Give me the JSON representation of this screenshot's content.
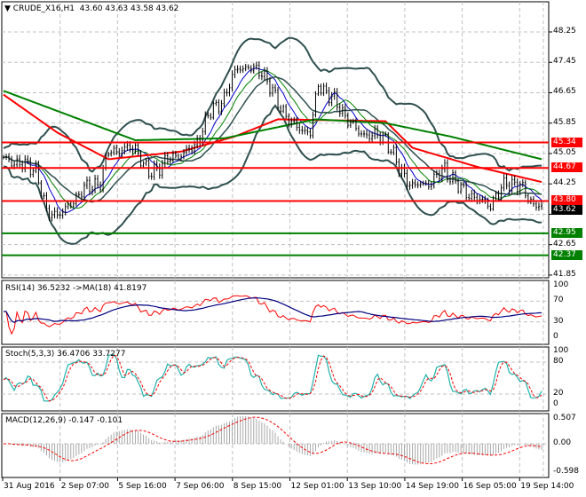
{
  "header": {
    "symbol": "CRUDE_X16,H1",
    "ohlc": "43.60 43.63 43.58 43.62"
  },
  "price_axis": [
    "48.25",
    "47.45",
    "46.65",
    "45.85",
    "45.05",
    "44.25",
    "43.45",
    "42.65",
    "41.85"
  ],
  "hlines": [
    {
      "label": "45.34",
      "value": 45.34,
      "color": "#ff0000"
    },
    {
      "label": "44.67",
      "value": 44.67,
      "color": "#ff0000"
    },
    {
      "label": "43.80",
      "value": 43.8,
      "color": "#ff0000"
    },
    {
      "label": "42.95",
      "value": 42.95,
      "color": "#008000"
    },
    {
      "label": "42.37",
      "value": 42.37,
      "color": "#008000"
    }
  ],
  "current_price": {
    "label": "43.62",
    "value": 43.62
  },
  "time_axis": [
    "31 Aug 2016",
    "2 Sep 07:00",
    "5 Sep 16:00",
    "7 Sep 06:00",
    "8 Sep 15:00",
    "12 Sep 01:00",
    "13 Sep 10:00",
    "14 Sep 19:00",
    "16 Sep 05:00",
    "19 Sep 14:00"
  ],
  "rsi": {
    "header": "RSI(14) 36.5232  ->MA(18) 41.8197",
    "axis": [
      "100",
      "70",
      "30",
      "0"
    ]
  },
  "stoch": {
    "header": "Stoch(5,3,3) 36.4706 33.7277",
    "axis": [
      "100",
      "80",
      "20",
      "0"
    ]
  },
  "macd": {
    "header": "MACD(12,26,9) -0.147 -0.101",
    "axis": [
      "0.507",
      "0.00",
      "-0.598"
    ]
  },
  "chart_data": {
    "type": "candlestick",
    "title": "CRUDE_X16,H1",
    "bars": 201,
    "ylim": [
      41.85,
      48.25
    ],
    "close_keypoints": [
      [
        0,
        44.9
      ],
      [
        1,
        44.89
      ],
      [
        12,
        44.65
      ],
      [
        16,
        43.48
      ],
      [
        22,
        43.48
      ],
      [
        29,
        44.07
      ],
      [
        36,
        44.3
      ],
      [
        39,
        45.1
      ],
      [
        49,
        45.2
      ],
      [
        54,
        44.5
      ],
      [
        61,
        44.88
      ],
      [
        71,
        45.2
      ],
      [
        76,
        46.05
      ],
      [
        82,
        46.52
      ],
      [
        87,
        47.34
      ],
      [
        96,
        47.22
      ],
      [
        101,
        46.52
      ],
      [
        107,
        45.82
      ],
      [
        114,
        45.59
      ],
      [
        117,
        46.87
      ],
      [
        122,
        46.52
      ],
      [
        127,
        46.05
      ],
      [
        132,
        45.59
      ],
      [
        142,
        45.47
      ],
      [
        147,
        44.65
      ],
      [
        152,
        44.18
      ],
      [
        159,
        44.3
      ],
      [
        164,
        44.65
      ],
      [
        169,
        44.18
      ],
      [
        176,
        43.83
      ],
      [
        181,
        43.72
      ],
      [
        187,
        44.3
      ],
      [
        192,
        44.18
      ],
      [
        197,
        43.72
      ],
      [
        200,
        43.62
      ]
    ],
    "ma_red_keypoints": [
      [
        0,
        46.6
      ],
      [
        20,
        45.6
      ],
      [
        39,
        44.9
      ],
      [
        66,
        45.1
      ],
      [
        86,
        45.5
      ],
      [
        102,
        45.95
      ],
      [
        142,
        45.9
      ],
      [
        152,
        45.2
      ],
      [
        176,
        44.7
      ],
      [
        200,
        44.3
      ]
    ],
    "ma_green_keypoints": [
      [
        0,
        46.7
      ],
      [
        49,
        45.4
      ],
      [
        82,
        45.45
      ],
      [
        116,
        45.95
      ],
      [
        142,
        45.85
      ],
      [
        166,
        45.5
      ],
      [
        200,
        44.9
      ]
    ]
  },
  "colors": {
    "red": "#ff0000",
    "green": "#008000",
    "band": "#2f4f4f",
    "grid": "#c0c0c0",
    "axis_text": "#000000"
  }
}
